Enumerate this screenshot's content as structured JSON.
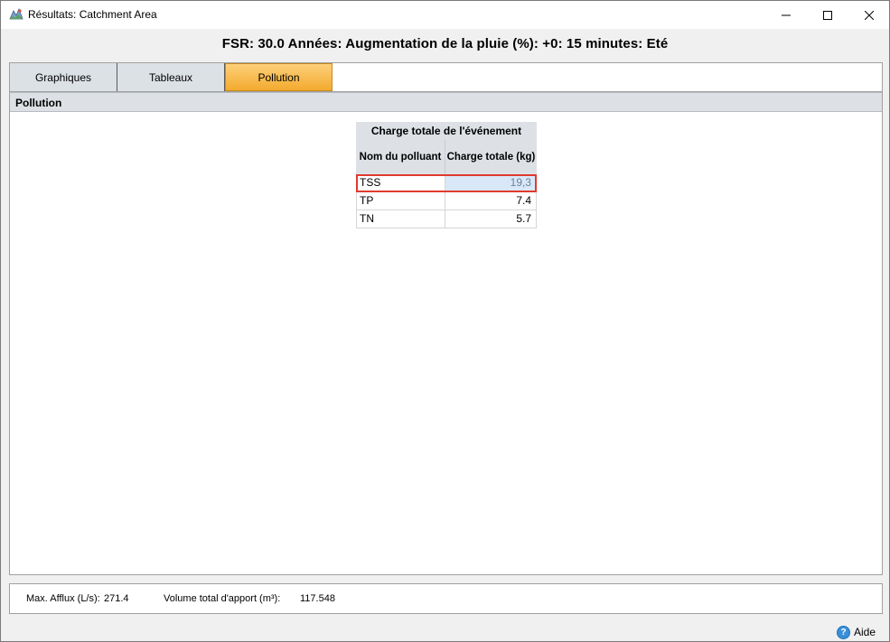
{
  "window": {
    "title": "Résultats: Catchment Area",
    "controls": {
      "minimize": "minimize-icon",
      "maximize": "maximize-icon",
      "close": "close-icon"
    }
  },
  "header": {
    "text": "FSR:  30.0 Années: Augmentation de la pluie (%): +0: 15 minutes: Eté"
  },
  "tabs": [
    {
      "label": "Graphiques",
      "active": false
    },
    {
      "label": "Tableaux",
      "active": false
    },
    {
      "label": "Pollution",
      "active": true
    }
  ],
  "panel": {
    "title": "Pollution"
  },
  "table": {
    "caption": "Charge totale de l'événement",
    "columns": [
      "Nom du polluant",
      "Charge totale (kg)"
    ],
    "rows": [
      {
        "name": "TSS",
        "value": "19,3",
        "selected": true
      },
      {
        "name": "TP",
        "value": "7.4",
        "selected": false
      },
      {
        "name": "TN",
        "value": "5.7",
        "selected": false
      }
    ]
  },
  "status": {
    "max_afflux_label": "Max. Afflux (L/s):",
    "max_afflux_value": "271.4",
    "volume_label": "Volume total d'apport (m³):",
    "volume_value": "117.548"
  },
  "help": {
    "label": "Aide",
    "icon": "help-icon"
  },
  "colors": {
    "active_tab": "#f4aa2e",
    "selection_outline": "#e03a2e",
    "selected_cell": "#d9e8f8"
  }
}
